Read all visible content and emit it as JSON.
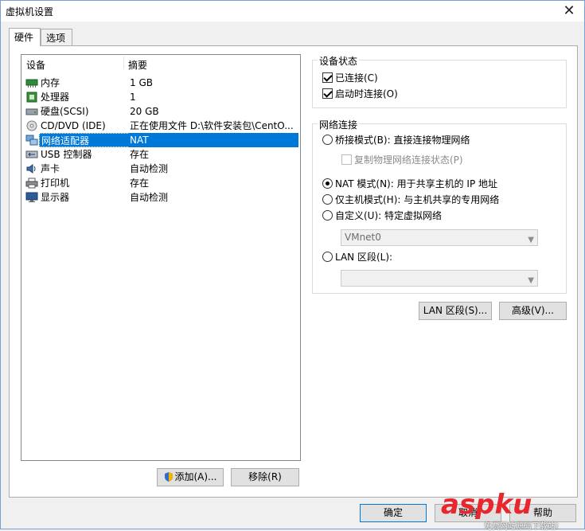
{
  "window": {
    "title": "虚拟机设置",
    "close_glyph": "✕"
  },
  "tabs": [
    {
      "label": "硬件"
    },
    {
      "label": "选项"
    }
  ],
  "device_list": {
    "headers": {
      "device": "设备",
      "summary": "摘要"
    },
    "rows": [
      {
        "name": "内存",
        "summary": "1 GB",
        "icon": "memory-icon",
        "selected": false
      },
      {
        "name": "处理器",
        "summary": "1",
        "icon": "processor-icon",
        "selected": false
      },
      {
        "name": "硬盘(SCSI)",
        "summary": "20 GB",
        "icon": "hard-disk-icon",
        "selected": false
      },
      {
        "name": "CD/DVD (IDE)",
        "summary": "正在使用文件 D:\\软件安装包\\CentO...",
        "icon": "cd-dvd-icon",
        "selected": false
      },
      {
        "name": "网络适配器",
        "summary": "NAT",
        "icon": "network-adapter-icon",
        "selected": true
      },
      {
        "name": "USB 控制器",
        "summary": "存在",
        "icon": "usb-icon",
        "selected": false
      },
      {
        "name": "声卡",
        "summary": "自动检测",
        "icon": "sound-card-icon",
        "selected": false
      },
      {
        "name": "打印机",
        "summary": "存在",
        "icon": "printer-icon",
        "selected": false
      },
      {
        "name": "显示器",
        "summary": "自动检测",
        "icon": "display-icon",
        "selected": false
      }
    ]
  },
  "list_buttons": {
    "add": "添加(A)...",
    "remove": "移除(R)"
  },
  "device_status": {
    "title": "设备状态",
    "connected": {
      "label": "已连接(C)",
      "checked": true
    },
    "connect_at_power_on": {
      "label": "启动时连接(O)",
      "checked": true
    }
  },
  "network_connection": {
    "title": "网络连接",
    "bridged": {
      "label": "桥接模式(B): 直接连接物理网络",
      "checked": false
    },
    "replicate": {
      "label": "复制物理网络连接状态(P)",
      "checked": false,
      "enabled": false
    },
    "nat": {
      "label": "NAT 模式(N): 用于共享主机的 IP 地址",
      "checked": true
    },
    "host_only": {
      "label": "仅主机模式(H): 与主机共享的专用网络",
      "checked": false
    },
    "custom": {
      "label": "自定义(U): 特定虚拟网络",
      "checked": false
    },
    "custom_select_value": "VMnet0",
    "lan_segment": {
      "label": "LAN 区段(L):",
      "checked": false
    },
    "lan_select_value": ""
  },
  "right_buttons": {
    "lan_segments": "LAN 区段(S)...",
    "advanced": "高级(V)..."
  },
  "footer": {
    "ok": "确定",
    "cancel": "取消",
    "help": "帮助"
  },
  "watermark": {
    "logo": "aspku",
    "sub": "免费网站源码下载站!"
  },
  "colors": {
    "selection": "#0078d7",
    "watermark_red": "#e8262e"
  }
}
